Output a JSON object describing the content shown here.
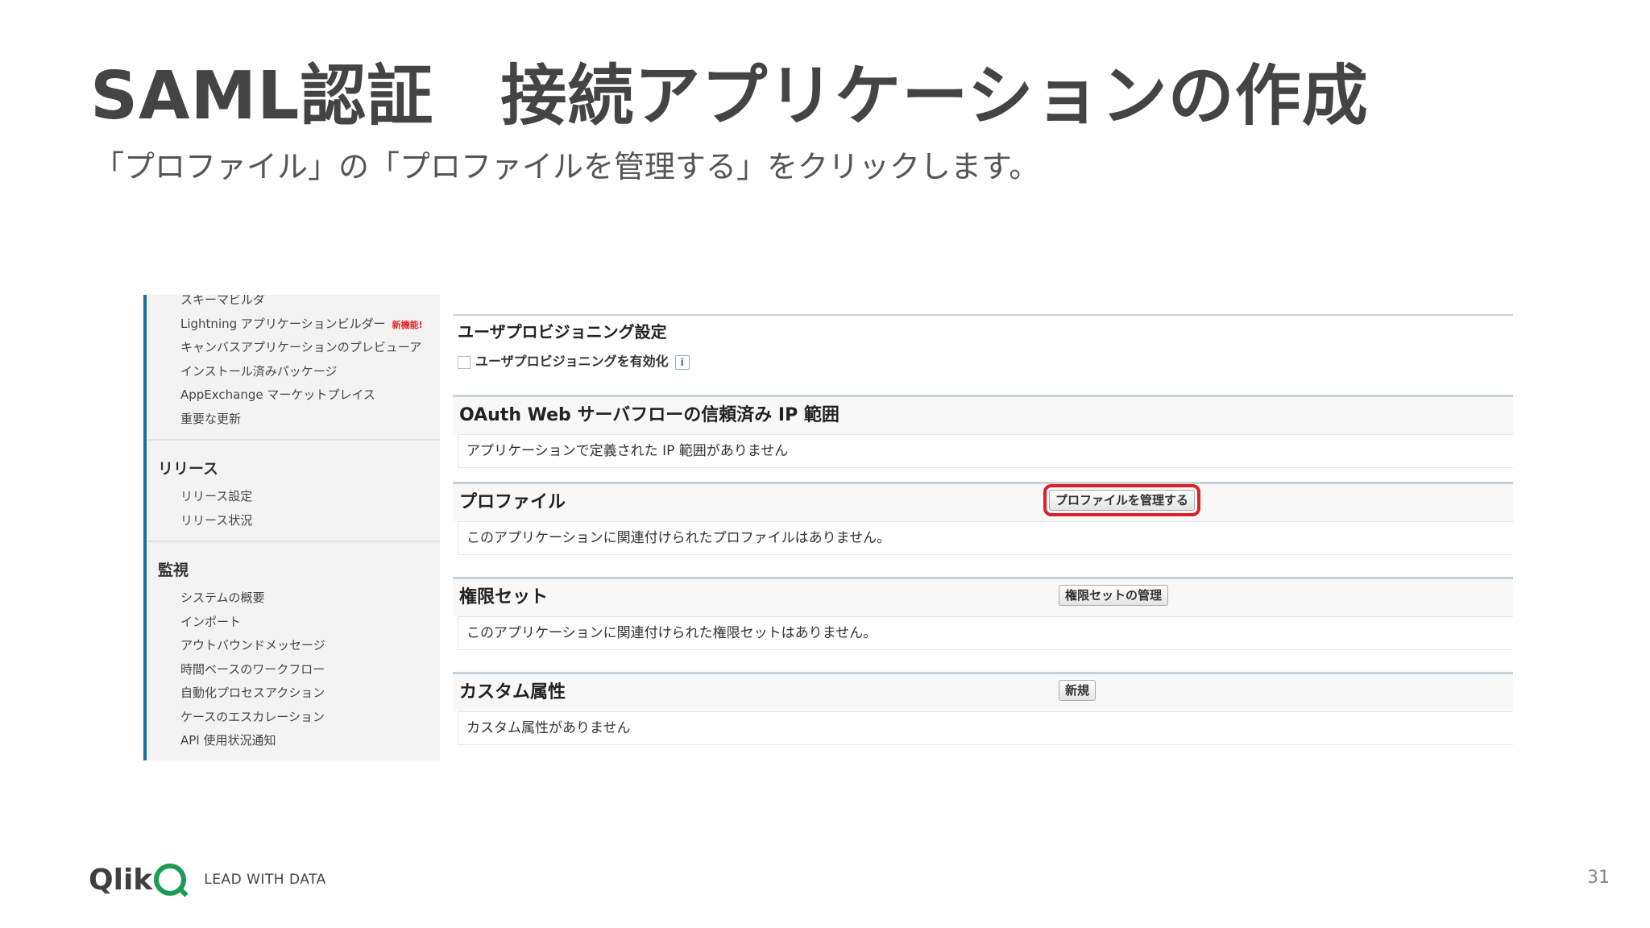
{
  "slide": {
    "title": "SAML認証　接続アプリケーションの作成",
    "subtitle": "「プロファイル」の「プロファイルを管理する」をクリックします。",
    "page_number": "31"
  },
  "logo": {
    "word": "Qlik",
    "tagline": "LEAD WITH DATA"
  },
  "sidebar": {
    "top_items": [
      "スキーマビルダ",
      "Lightning アプリケーションビルダー",
      "キャンバスアプリケーションのプレビューア",
      "インストール済みパッケージ",
      "AppExchange マーケットプレイス",
      "重要な更新"
    ],
    "new_badge": "新機能!",
    "release": {
      "heading": "リリース",
      "items": [
        "リリース設定",
        "リリース状況"
      ]
    },
    "monitor": {
      "heading": "監視",
      "items": [
        "システムの概要",
        "インポート",
        "アウトバウンドメッセージ",
        "時間ベースのワークフロー",
        "自動化プロセスアクション",
        "ケースのエスカレーション",
        "API 使用状況通知"
      ]
    }
  },
  "sections": {
    "provisioning": {
      "title": "ユーザプロビジョニング設定",
      "checkbox_label": "ユーザプロビジョニングを有効化",
      "info": "i"
    },
    "oauth": {
      "title": "OAuth Web サーバフローの信頼済み IP 範囲",
      "body": "アプリケーションで定義された IP 範囲がありません"
    },
    "profile": {
      "title": "プロファイル",
      "button": "プロファイルを管理する",
      "body": "このアプリケーションに関連付けられたプロファイルはありません。"
    },
    "permset": {
      "title": "権限セット",
      "button": "権限セットの管理",
      "body": "このアプリケーションに関連付けられた権限セットはありません。"
    },
    "custom": {
      "title": "カスタム属性",
      "button": "新規",
      "body": "カスタム属性がありません"
    }
  },
  "colors": {
    "highlight": "#d9212a",
    "sidebar_accent": "#1b6f9a",
    "logo_green": "#1a9c54"
  }
}
